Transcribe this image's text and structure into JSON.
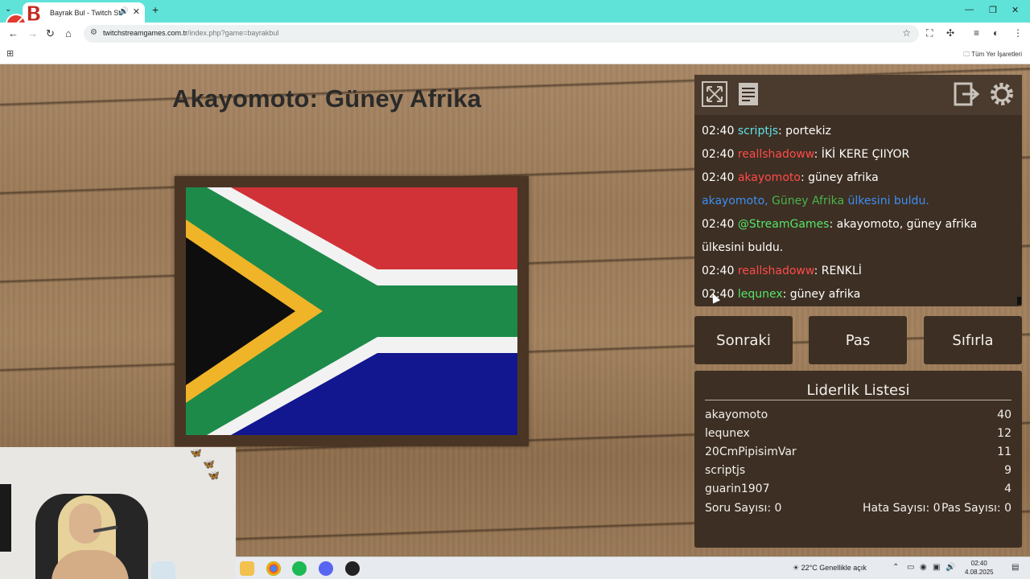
{
  "browser": {
    "tab_title": "Bayrak Bul - Twitch Stream",
    "url_domain": "twitchstreamgames.com.tr",
    "url_path": "/index.php?game=bayrakbul",
    "bookmarks_label": "Tüm Yer İşaretleri"
  },
  "game": {
    "title": "Akayomoto: Güney Afrika",
    "flag_country": "Güney Afrika"
  },
  "chat": {
    "messages": [
      {
        "time": "02:40",
        "user": "scriptjs",
        "user_color": "#5fe2ea",
        "text": ": portekiz"
      },
      {
        "time": "02:40",
        "user": "reallshadoww",
        "user_color": "#ff4b4b",
        "text": ": İKİ KERE ÇIIYOR"
      },
      {
        "time": "02:40",
        "user": "akayomoto",
        "user_color": "#ff4b4b",
        "text": ": güney afrika"
      },
      {
        "system": true,
        "user": "akayomoto,",
        "country": "Güney Afrika",
        "suffix": "ülkesini buldu."
      },
      {
        "time": "02:40",
        "user": "@StreamGames",
        "user_color": "#55e56b",
        "text": ": akayomoto, güney afrika ülkesini buldu."
      },
      {
        "time": "02:40",
        "user": "reallshadoww",
        "user_color": "#ff4b4b",
        "text": ": RENKLİ"
      },
      {
        "time": "02:40",
        "user": "lequnex",
        "user_color": "#55e56b",
        "text": ": güney afrika"
      }
    ]
  },
  "controls": {
    "next_label": "Sonraki",
    "pass_label": "Pas",
    "reset_label": "Sıfırla"
  },
  "leaderboard": {
    "title": "Liderlik Listesi",
    "rows": [
      {
        "name": "akayomoto",
        "score": "40"
      },
      {
        "name": "lequnex",
        "score": "12"
      },
      {
        "name": "20CmPipisimVar",
        "score": "11"
      },
      {
        "name": "scriptjs",
        "score": "9"
      },
      {
        "name": "guarin1907",
        "score": "4"
      }
    ],
    "question_count": "Soru Sayısı: 0",
    "error_count": "Hata Sayısı: 0",
    "pass_count": "Pas Sayısı: 0"
  },
  "taskbar": {
    "weather": "22°C  Genellikle açık",
    "time": "02:40",
    "date": "4.08.2025"
  }
}
